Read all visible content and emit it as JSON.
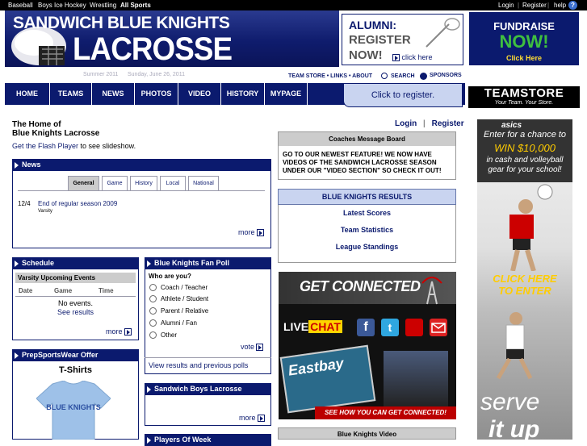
{
  "topbar": {
    "left_links": [
      "Baseball",
      "Boys Ice Hockey",
      "Wrestling",
      "All Sports"
    ],
    "right_links": [
      "Login",
      "Register",
      "help"
    ]
  },
  "header": {
    "title_line1": "SANDWICH BLUE KNIGHTS",
    "title_line2": "LACROSSE",
    "alumni_title": "ALUMNI:",
    "alumni_line2": "REGISTER",
    "alumni_line3": "NOW!",
    "alumni_click": "click here",
    "fundraise_title": "FUNDRAISE",
    "fundraise_now": "NOW!",
    "fundraise_click": "Click Here"
  },
  "subheader": {
    "season": "Summer 2011",
    "date": "Sunday, June 26, 2011",
    "links": "TEAM STORE • LINKS • ABOUT",
    "search": "SEARCH",
    "sponsors": "SPONSORS"
  },
  "nav": {
    "items": [
      "HOME",
      "TEAMS",
      "NEWS",
      "PHOTOS",
      "VIDEO",
      "HISTORY",
      "MYPAGE"
    ],
    "register": "Click to register."
  },
  "teamstore": {
    "title": "TEAMSTORE",
    "tagline": "Your Team. Your Store."
  },
  "intro": {
    "line1": "The Home of",
    "line2": "Blue Knights Lacrosse",
    "flash_link": "Get the Flash Player",
    "flash_rest": " to see slideshow."
  },
  "news": {
    "header": "News",
    "tabs": [
      "General",
      "Game",
      "History",
      "Local",
      "National"
    ],
    "items": [
      {
        "date": "12/4",
        "title": "End of regular season 2009",
        "sub": "Varsity"
      }
    ],
    "more": "more"
  },
  "schedule": {
    "header": "Schedule",
    "subheader": "Varsity Upcoming Events",
    "cols": [
      "Date",
      "Game",
      "Time"
    ],
    "empty": "No events.",
    "results": "See results",
    "more": "more"
  },
  "poll": {
    "header": "Blue Knights Fan Poll",
    "question": "Who are you?",
    "options": [
      "Coach / Teacher",
      "Athlete / Student",
      "Parent / Relative",
      "Alumni / Fan",
      "Other"
    ],
    "vote": "vote",
    "view_results": "View results and previous polls"
  },
  "prep": {
    "header": "PrepSportsWear Offer",
    "item": "T-Shirts"
  },
  "boys": {
    "header": "Sandwich Boys Lacrosse",
    "more": "more"
  },
  "players": {
    "header": "Players Of Week"
  },
  "auth": {
    "login": "Login",
    "sep": "|",
    "register": "Register"
  },
  "coaches": {
    "header": "Coaches Message Board",
    "message": "GO TO OUR NEWEST FEATURE! WE NOW HAVE VIDEOS OF THE SANDWICH LACROSSE SEASON UNDER OUR \"VIDEO SECTION\" SO CHECK IT OUT!"
  },
  "results": {
    "header": "BLUE KNIGHTS RESULTS",
    "links": [
      "Latest Scores",
      "Team Statistics",
      "League Standings"
    ]
  },
  "connected": {
    "title": "GET CONNECTED",
    "livechat_live": "LIVE",
    "livechat_chat": "CHAT",
    "eastbay": "Eastbay",
    "cta": "SEE HOW YOU CAN GET CONNECTED!"
  },
  "video": {
    "header": "Blue Knights Video"
  },
  "asics": {
    "brand": "asics",
    "line1": "Enter for a chance to",
    "win": "WIN $10,000",
    "line2": "in cash and volleyball gear for your school!",
    "click": "CLICK HERE",
    "enter": "TO ENTER",
    "serve": "serve",
    "itup": "it up"
  }
}
